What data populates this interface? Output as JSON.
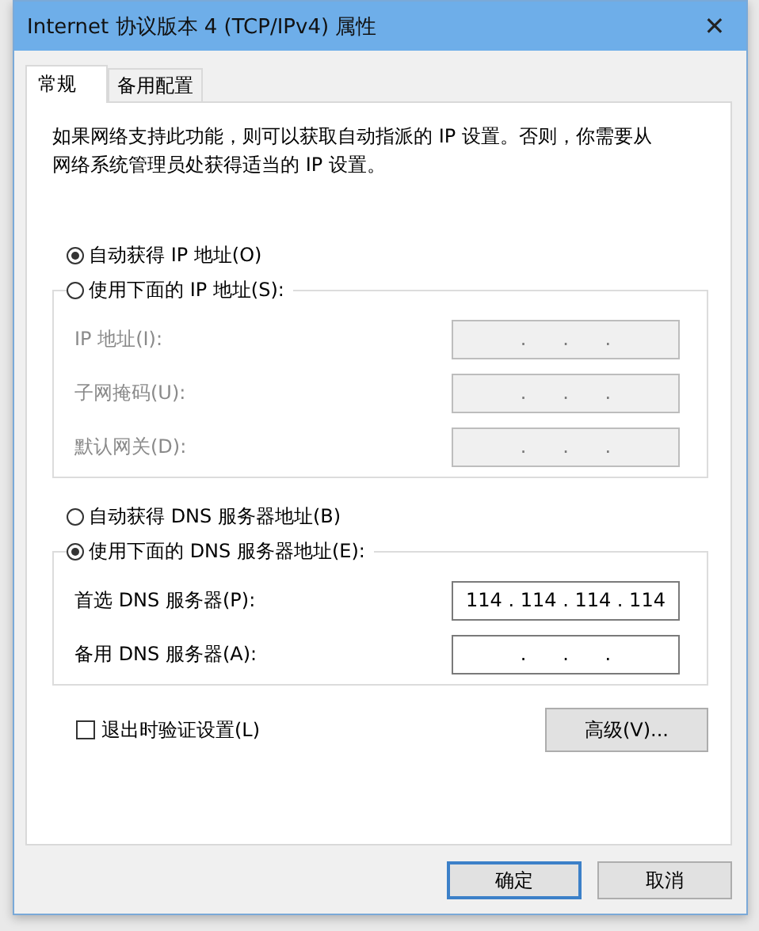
{
  "window": {
    "title": "Internet 协议版本 4 (TCP/IPv4) 属性",
    "close": "✕"
  },
  "tabs": [
    {
      "label": "常规",
      "selected": true
    },
    {
      "label": "备用配置",
      "selected": false
    }
  ],
  "description": "如果网络支持此功能，则可以获取自动指派的 IP 设置。否则，你需要从网络系统管理员处获得适当的 IP 设置。",
  "ip_options": [
    {
      "label": "自动获得 IP 地址(O)",
      "selected": true
    },
    {
      "label": "使用下面的 IP 地址(S):",
      "selected": false
    }
  ],
  "ip_fields": [
    {
      "label": "IP 地址(I):",
      "value": ".      .      .",
      "disabled": true
    },
    {
      "label": "子网掩码(U):",
      "value": ".      .      .",
      "disabled": true
    },
    {
      "label": "默认网关(D):",
      "value": ".      .      .",
      "disabled": true
    }
  ],
  "dns_options": [
    {
      "label": "自动获得 DNS 服务器地址(B)",
      "selected": false
    },
    {
      "label": "使用下面的 DNS 服务器地址(E):",
      "selected": true
    }
  ],
  "dns_fields": [
    {
      "label": "首选 DNS 服务器(P):",
      "value": "114 . 114 . 114 . 114",
      "disabled": false
    },
    {
      "label": "备用 DNS 服务器(A):",
      "value": ".      .      .",
      "disabled": false
    }
  ],
  "validate": {
    "label": "退出时验证设置(L)",
    "checked": false
  },
  "advanced_button": "高级(V)...",
  "buttons": [
    {
      "label": "确定",
      "default": true
    },
    {
      "label": "取消",
      "default": false
    }
  ]
}
